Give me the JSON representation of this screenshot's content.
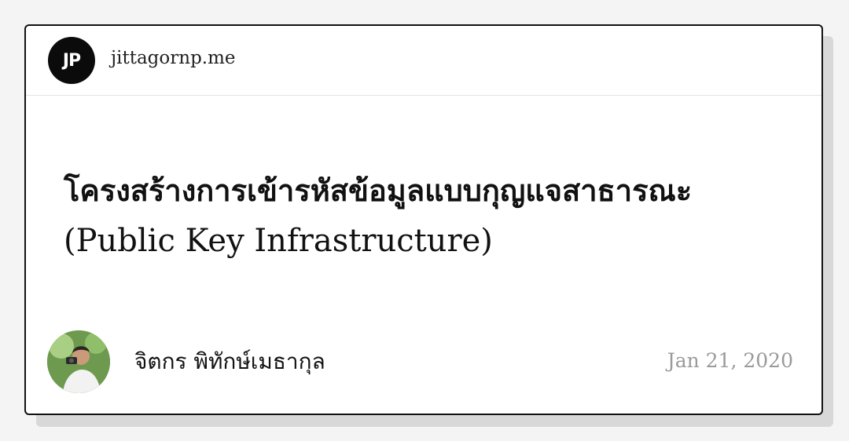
{
  "card": {
    "site_logo_text": "JP",
    "site_name": "jittagornp.me",
    "title_line1": "โครงสร้างการเข้ารหัสข้อมูลแบบกุญแจสาธารณะ",
    "title_line2": "(Public Key Infrastructure)",
    "author_name": "จิตกร พิทักษ์เมธากุล",
    "date": "Jan 21, 2020"
  }
}
